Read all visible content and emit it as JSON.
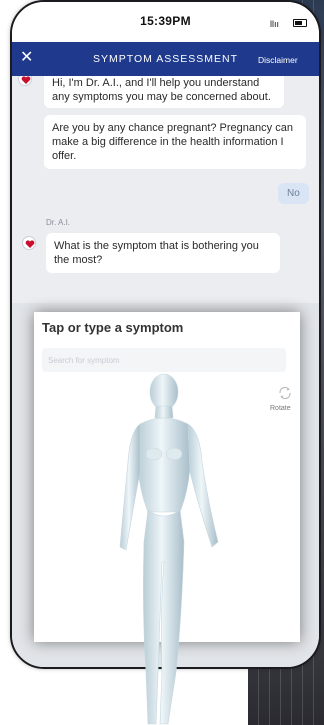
{
  "status_bar": {
    "time": "15:39PM",
    "signal": "llıı"
  },
  "app_bar": {
    "title": "SYMPTOM ASSESSMENT",
    "close": "✕",
    "disclaimer": "Disclaimer"
  },
  "chat": {
    "messages": [
      {
        "from": "bot",
        "text": "Hi, I'm Dr. A.I., and I'll help you understand any symptoms you may be concerned about."
      },
      {
        "from": "bot",
        "text": "Are you by any chance pregnant? Pregnancy can make a big difference in the health information I offer."
      },
      {
        "from": "user",
        "text": "No"
      },
      {
        "from": "bot",
        "sender": "Dr. A.I.",
        "text": "What is the symptom that is bothering you the most?"
      }
    ]
  },
  "symptom_panel": {
    "title": "Tap or type a symptom",
    "search_placeholder": "Search for symptom",
    "rotate_label": "Rotate"
  },
  "colors": {
    "app_bar": "#1f3a8c",
    "chat_bg": "#ebedf1",
    "user_bubble": "#d9e5f5",
    "heart": "#c8102e"
  },
  "icons": {
    "close": "close-icon",
    "rotate": "rotate-icon",
    "avatar": "heart-avatar-icon"
  }
}
